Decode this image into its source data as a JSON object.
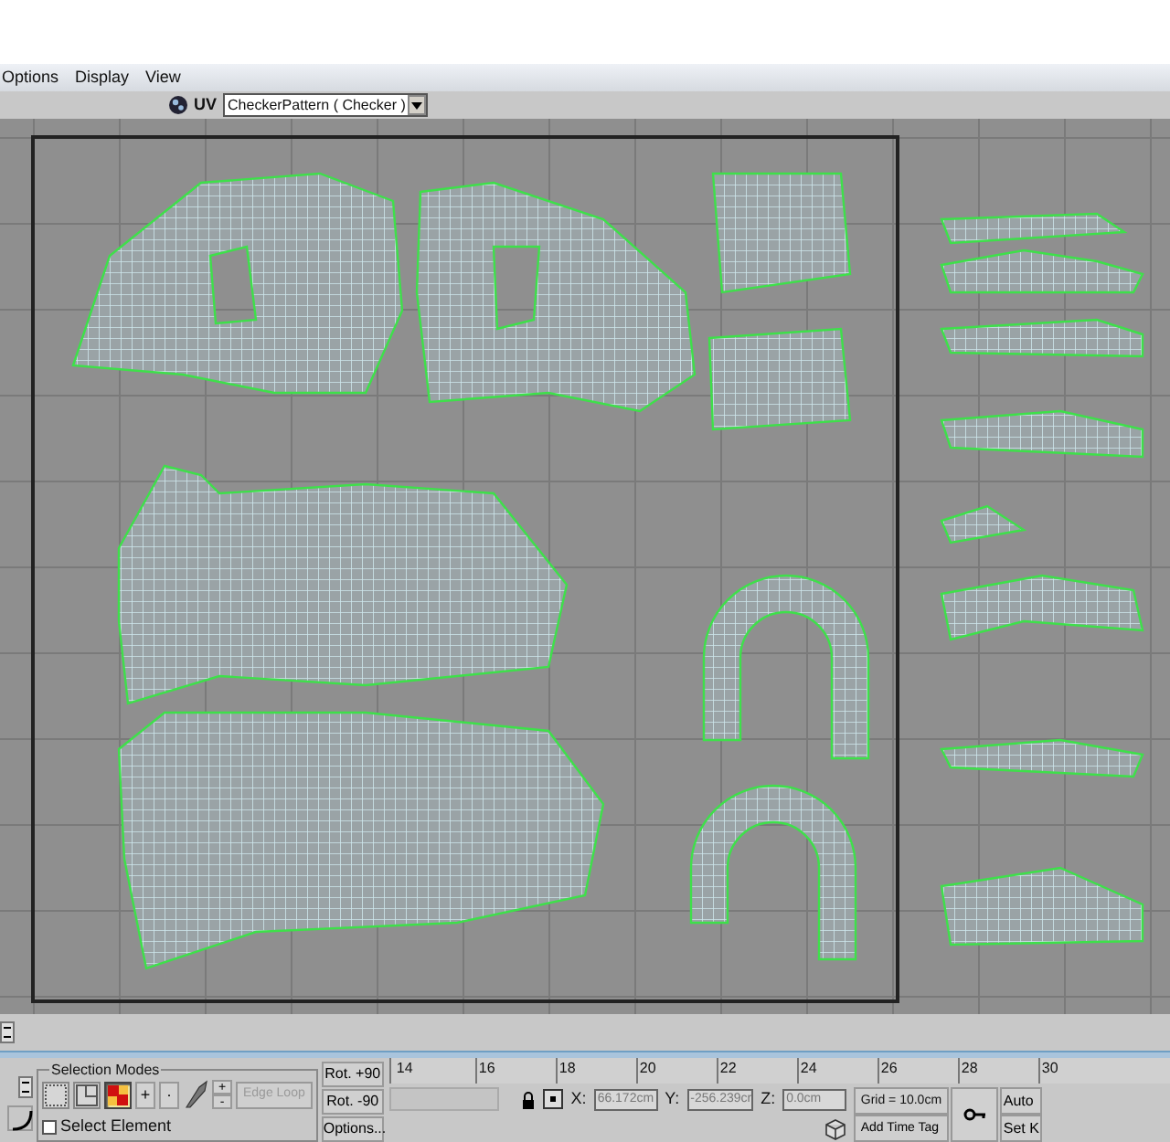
{
  "menu": [
    {
      "label": "Options"
    },
    {
      "label": "Display"
    },
    {
      "label": "View"
    }
  ],
  "toolbar": {
    "uv_label": "UV",
    "map_dropdown": "CheckerPattern  ( Checker )"
  },
  "selection_modes": {
    "title": "Selection Modes",
    "modes": [
      {
        "kind": "vertex",
        "selected": false
      },
      {
        "kind": "edge",
        "selected": false
      },
      {
        "kind": "face",
        "selected": true
      }
    ],
    "grow": "+",
    "shrink": "·",
    "loop_up": "+",
    "loop_down": "-",
    "edge_loop": {
      "label": "Edge Loop",
      "disabled": true
    },
    "select_element": {
      "label": "Select Element",
      "checked": false
    }
  },
  "rotate_buttons": [
    "Rot. +90",
    "Rot. -90",
    "Options..."
  ],
  "ruler": [
    "14",
    "16",
    "18",
    "20",
    "22",
    "24",
    "26",
    "28",
    "30"
  ],
  "coordinates": [
    {
      "axis": "X:",
      "value": "66.172cm"
    },
    {
      "axis": "Y:",
      "value": "-256.239cr"
    },
    {
      "axis": "Z:",
      "value": "0.0cm"
    }
  ],
  "grid": "Grid = 10.0cm",
  "time_tag": "Add Time Tag",
  "key_buttons": [
    "Auto",
    "Set K"
  ]
}
